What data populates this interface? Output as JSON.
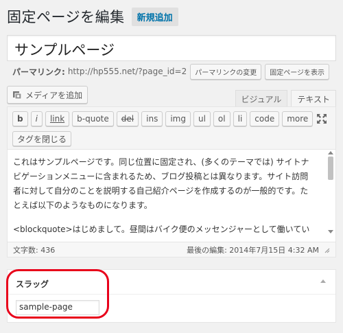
{
  "header": {
    "title": "固定ページを編集",
    "add_new": "新規追加"
  },
  "post": {
    "title_value": "サンプルページ",
    "permalink_label": "パーマリンク:",
    "permalink_url": "http://hp555.net/?page_id=2",
    "change_permalink": "パーマリンクの変更",
    "view_page": "固定ページを表示"
  },
  "media": {
    "add_media": "メディアを追加"
  },
  "tabs": {
    "visual": "ビジュアル",
    "text": "テキスト",
    "active": "text"
  },
  "quicktags": [
    {
      "label": "b",
      "style": "b"
    },
    {
      "label": "i",
      "style": "i"
    },
    {
      "label": "link",
      "style": "u"
    },
    {
      "label": "b-quote",
      "style": ""
    },
    {
      "label": "del",
      "style": "s"
    },
    {
      "label": "ins",
      "style": ""
    },
    {
      "label": "img",
      "style": ""
    },
    {
      "label": "ul",
      "style": ""
    },
    {
      "label": "ol",
      "style": ""
    },
    {
      "label": "li",
      "style": ""
    },
    {
      "label": "code",
      "style": ""
    },
    {
      "label": "more",
      "style": ""
    }
  ],
  "close_tags": "タグを閉じる",
  "content": {
    "paragraph1": "これはサンプルページです。同じ位置に固定され、(多くのテーマでは) サイトナビゲーションメニューに含まれるため、ブログ投稿とは異なります。サイト訪問者に対して自分のことを説明する自己紹介ページを作成するのが一般的です。たとえば以下のようなものになります。",
    "paragraph2": "<blockquote>はじめまして。昼間はバイク便のメッセンジャーとして働いていますが、俳優志望でもあります。これは僕のブログです。ロサンゼルスに住み"
  },
  "status": {
    "word_count": "文字数: 436",
    "last_edited": "最後の編集: 2014年7月15日 4:32 AM"
  },
  "slug_box": {
    "heading": "スラッグ",
    "value": "sample-page"
  },
  "colors": {
    "accent": "#0073aa",
    "highlight": "#e8001a"
  }
}
